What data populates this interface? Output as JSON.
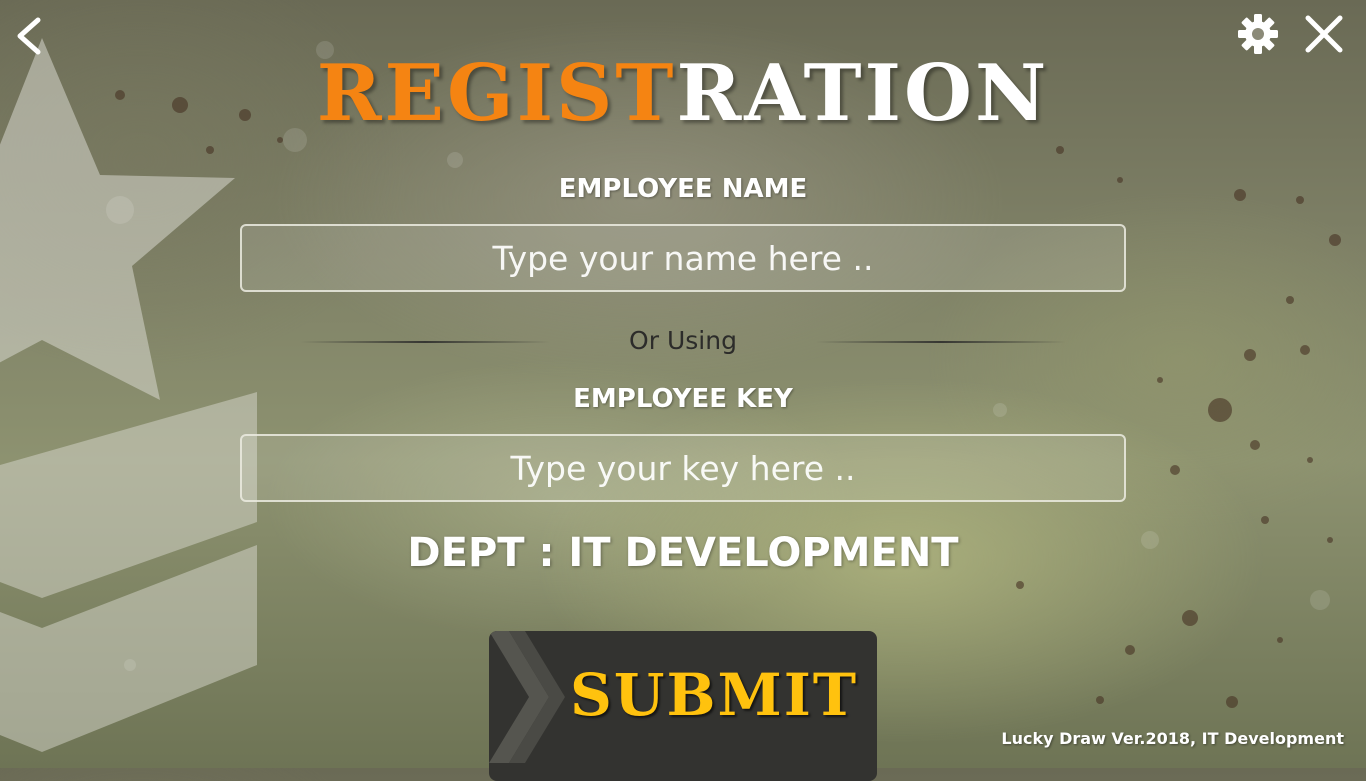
{
  "app": {
    "title_part1": "REGIST",
    "title_part2": "RATION",
    "title_colors": {
      "accent": "#f58412",
      "main": "#ffffff"
    }
  },
  "header": {
    "back_icon": "chevron-left-icon",
    "settings_icon": "gear-icon",
    "close_icon": "close-icon"
  },
  "form": {
    "name_label": "EMPLOYEE NAME",
    "name_placeholder": "Type your name here ..",
    "name_value": "",
    "divider_text": "Or Using",
    "key_label": "EMPLOYEE KEY",
    "key_placeholder": "Type your key here ..",
    "key_value": "",
    "dept_text": "DEPT : IT DEVELOPMENT"
  },
  "submit": {
    "label": "SUBMIT",
    "color": "#ffc20e",
    "icon": "chevron-right-icon"
  },
  "footer": {
    "version_text": "Lucky Draw Ver.2018, IT Development"
  }
}
